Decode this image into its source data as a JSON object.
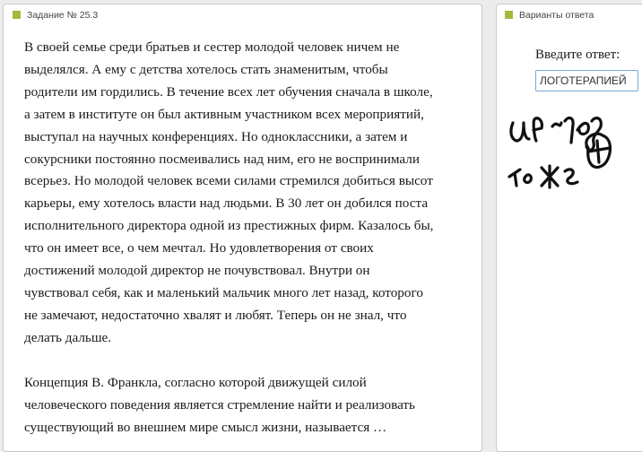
{
  "task": {
    "header": "Задание № 25.3",
    "text_lines": [
      "В своей семье среди братьев и сестер молодой человек ничем не",
      "выделялся. А ему с детства хотелось стать знаменитым, чтобы",
      "родители им гордились. В течение всех лет обучения сначала в школе,",
      "а затем в институте он был активным участником всех мероприятий,",
      "выступал на научных конференциях. Но одноклассники, а затем и",
      "сокурсники постоянно посмеивались над ним, его не воспринимали",
      "всерьез. Но молодой человек всеми силами стремился добиться высот",
      "карьеры, ему хотелось власти над людьми. В 30 лет он добился поста",
      "исполнительного директора одной из престижных фирм. Казалось бы,",
      "что он имеет все, о чем мечтал. Но удовлетворения от своих",
      "достижений молодой директор не почувствовал. Внутри он",
      "чувствовал себя, как и маленький мальчик много лет назад, которого",
      "не замечают, недостаточно хвалят и любят. Теперь он не знал, что",
      "делать дальше."
    ],
    "question_lines": [
      "Концепция В. Франкла, согласно которой движущей силой",
      "человеческого поведения является стремление найти и реализовать",
      "существующий во внешнем мире смысл жизни, называется …"
    ]
  },
  "answer": {
    "header": "Варианты ответа",
    "label": "Введите ответ:",
    "input_value": "ЛОГОТЕРАПИЕЙ"
  },
  "colors": {
    "header_square": "#a5b93a",
    "input_border": "#7aa7d8"
  }
}
